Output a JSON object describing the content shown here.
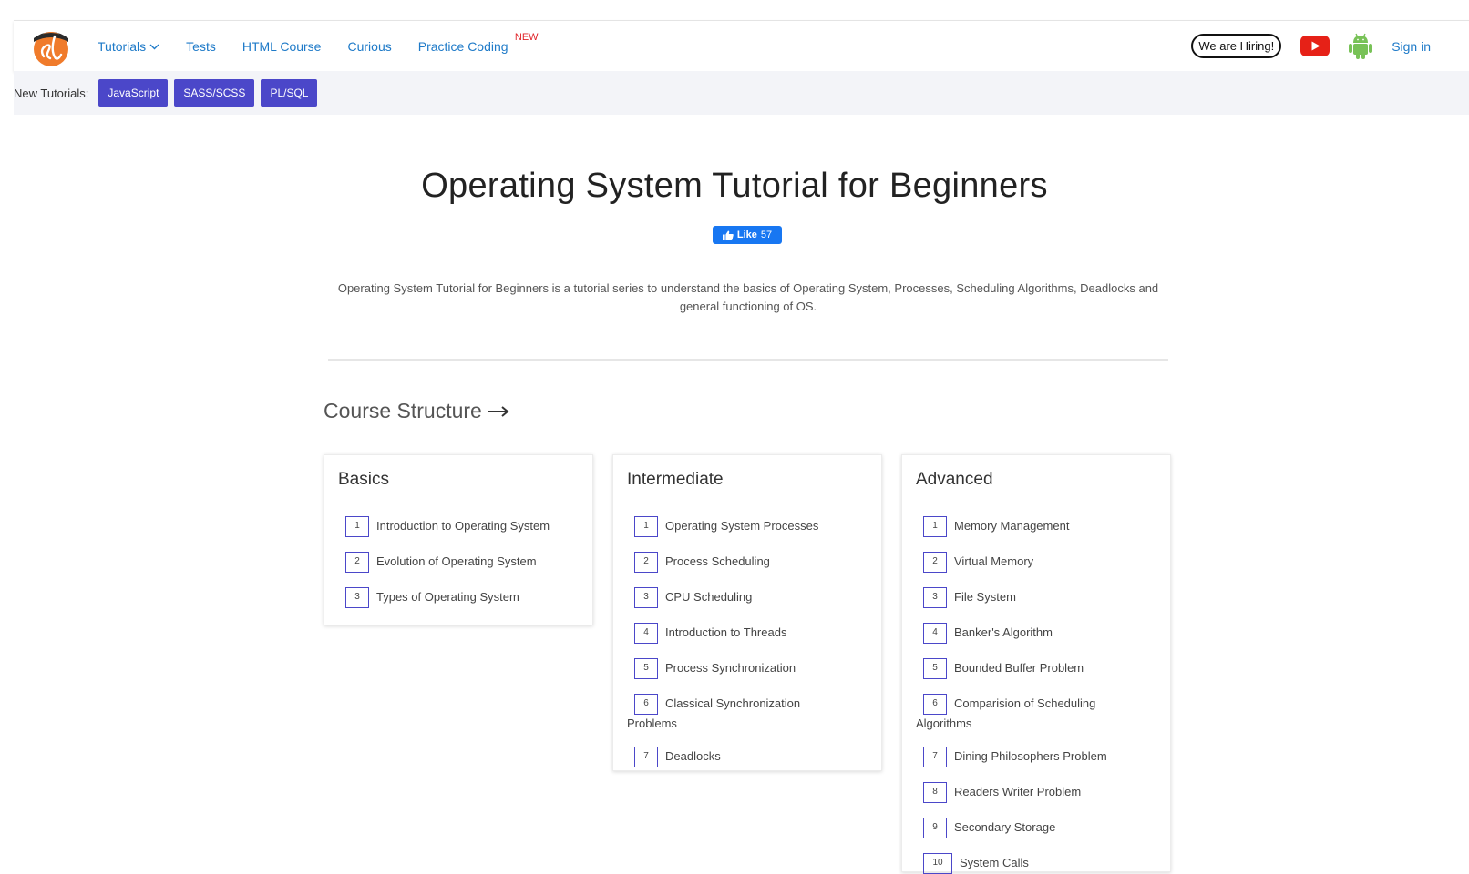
{
  "nav": {
    "links": [
      "Tutorials",
      "Tests",
      "HTML Course",
      "Curious",
      "Practice Coding"
    ],
    "new_badge": "NEW",
    "hiring": "We are Hiring!",
    "signin": "Sign in",
    "colors": {
      "link": "#1e7ac8",
      "badge": "#e0242a",
      "logo": "#f07b2b"
    }
  },
  "subbar": {
    "label": "New Tutorials:",
    "buttons": [
      "JavaScript",
      "SASS/SCSS",
      "PL/SQL"
    ]
  },
  "page": {
    "title": "Operating System Tutorial for Beginners",
    "like_label": "Like",
    "like_count": "57",
    "intro": "Operating System Tutorial for Beginners is a tutorial series to understand the basics of Operating System, Processes, Scheduling Algorithms, Deadlocks and general functioning of OS.",
    "course_heading": "Course Structure"
  },
  "cards": [
    {
      "title": "Basics",
      "topics": [
        {
          "n": "1",
          "label": "Introduction to Operating System"
        },
        {
          "n": "2",
          "label": "Evolution of Operating System"
        },
        {
          "n": "3",
          "label": "Types of Operating System"
        }
      ]
    },
    {
      "title": "Intermediate",
      "topics": [
        {
          "n": "1",
          "label": "Operating System Processes"
        },
        {
          "n": "2",
          "label": "Process Scheduling"
        },
        {
          "n": "3",
          "label": "CPU Scheduling"
        },
        {
          "n": "4",
          "label": "Introduction to Threads"
        },
        {
          "n": "5",
          "label": "Process Synchronization"
        },
        {
          "n": "6",
          "label": "Classical Synchronization Problems"
        },
        {
          "n": "7",
          "label": "Deadlocks"
        }
      ]
    },
    {
      "title": "Advanced",
      "topics": [
        {
          "n": "1",
          "label": "Memory Management"
        },
        {
          "n": "2",
          "label": "Virtual Memory"
        },
        {
          "n": "3",
          "label": "File System"
        },
        {
          "n": "4",
          "label": "Banker's Algorithm"
        },
        {
          "n": "5",
          "label": "Bounded Buffer Problem"
        },
        {
          "n": "6",
          "label": "Comparision of Scheduling Algorithms"
        },
        {
          "n": "7",
          "label": "Dining Philosophers Problem"
        },
        {
          "n": "8",
          "label": "Readers Writer Problem"
        },
        {
          "n": "9",
          "label": "Secondary Storage"
        },
        {
          "n": "10",
          "label": "System Calls"
        }
      ]
    }
  ]
}
